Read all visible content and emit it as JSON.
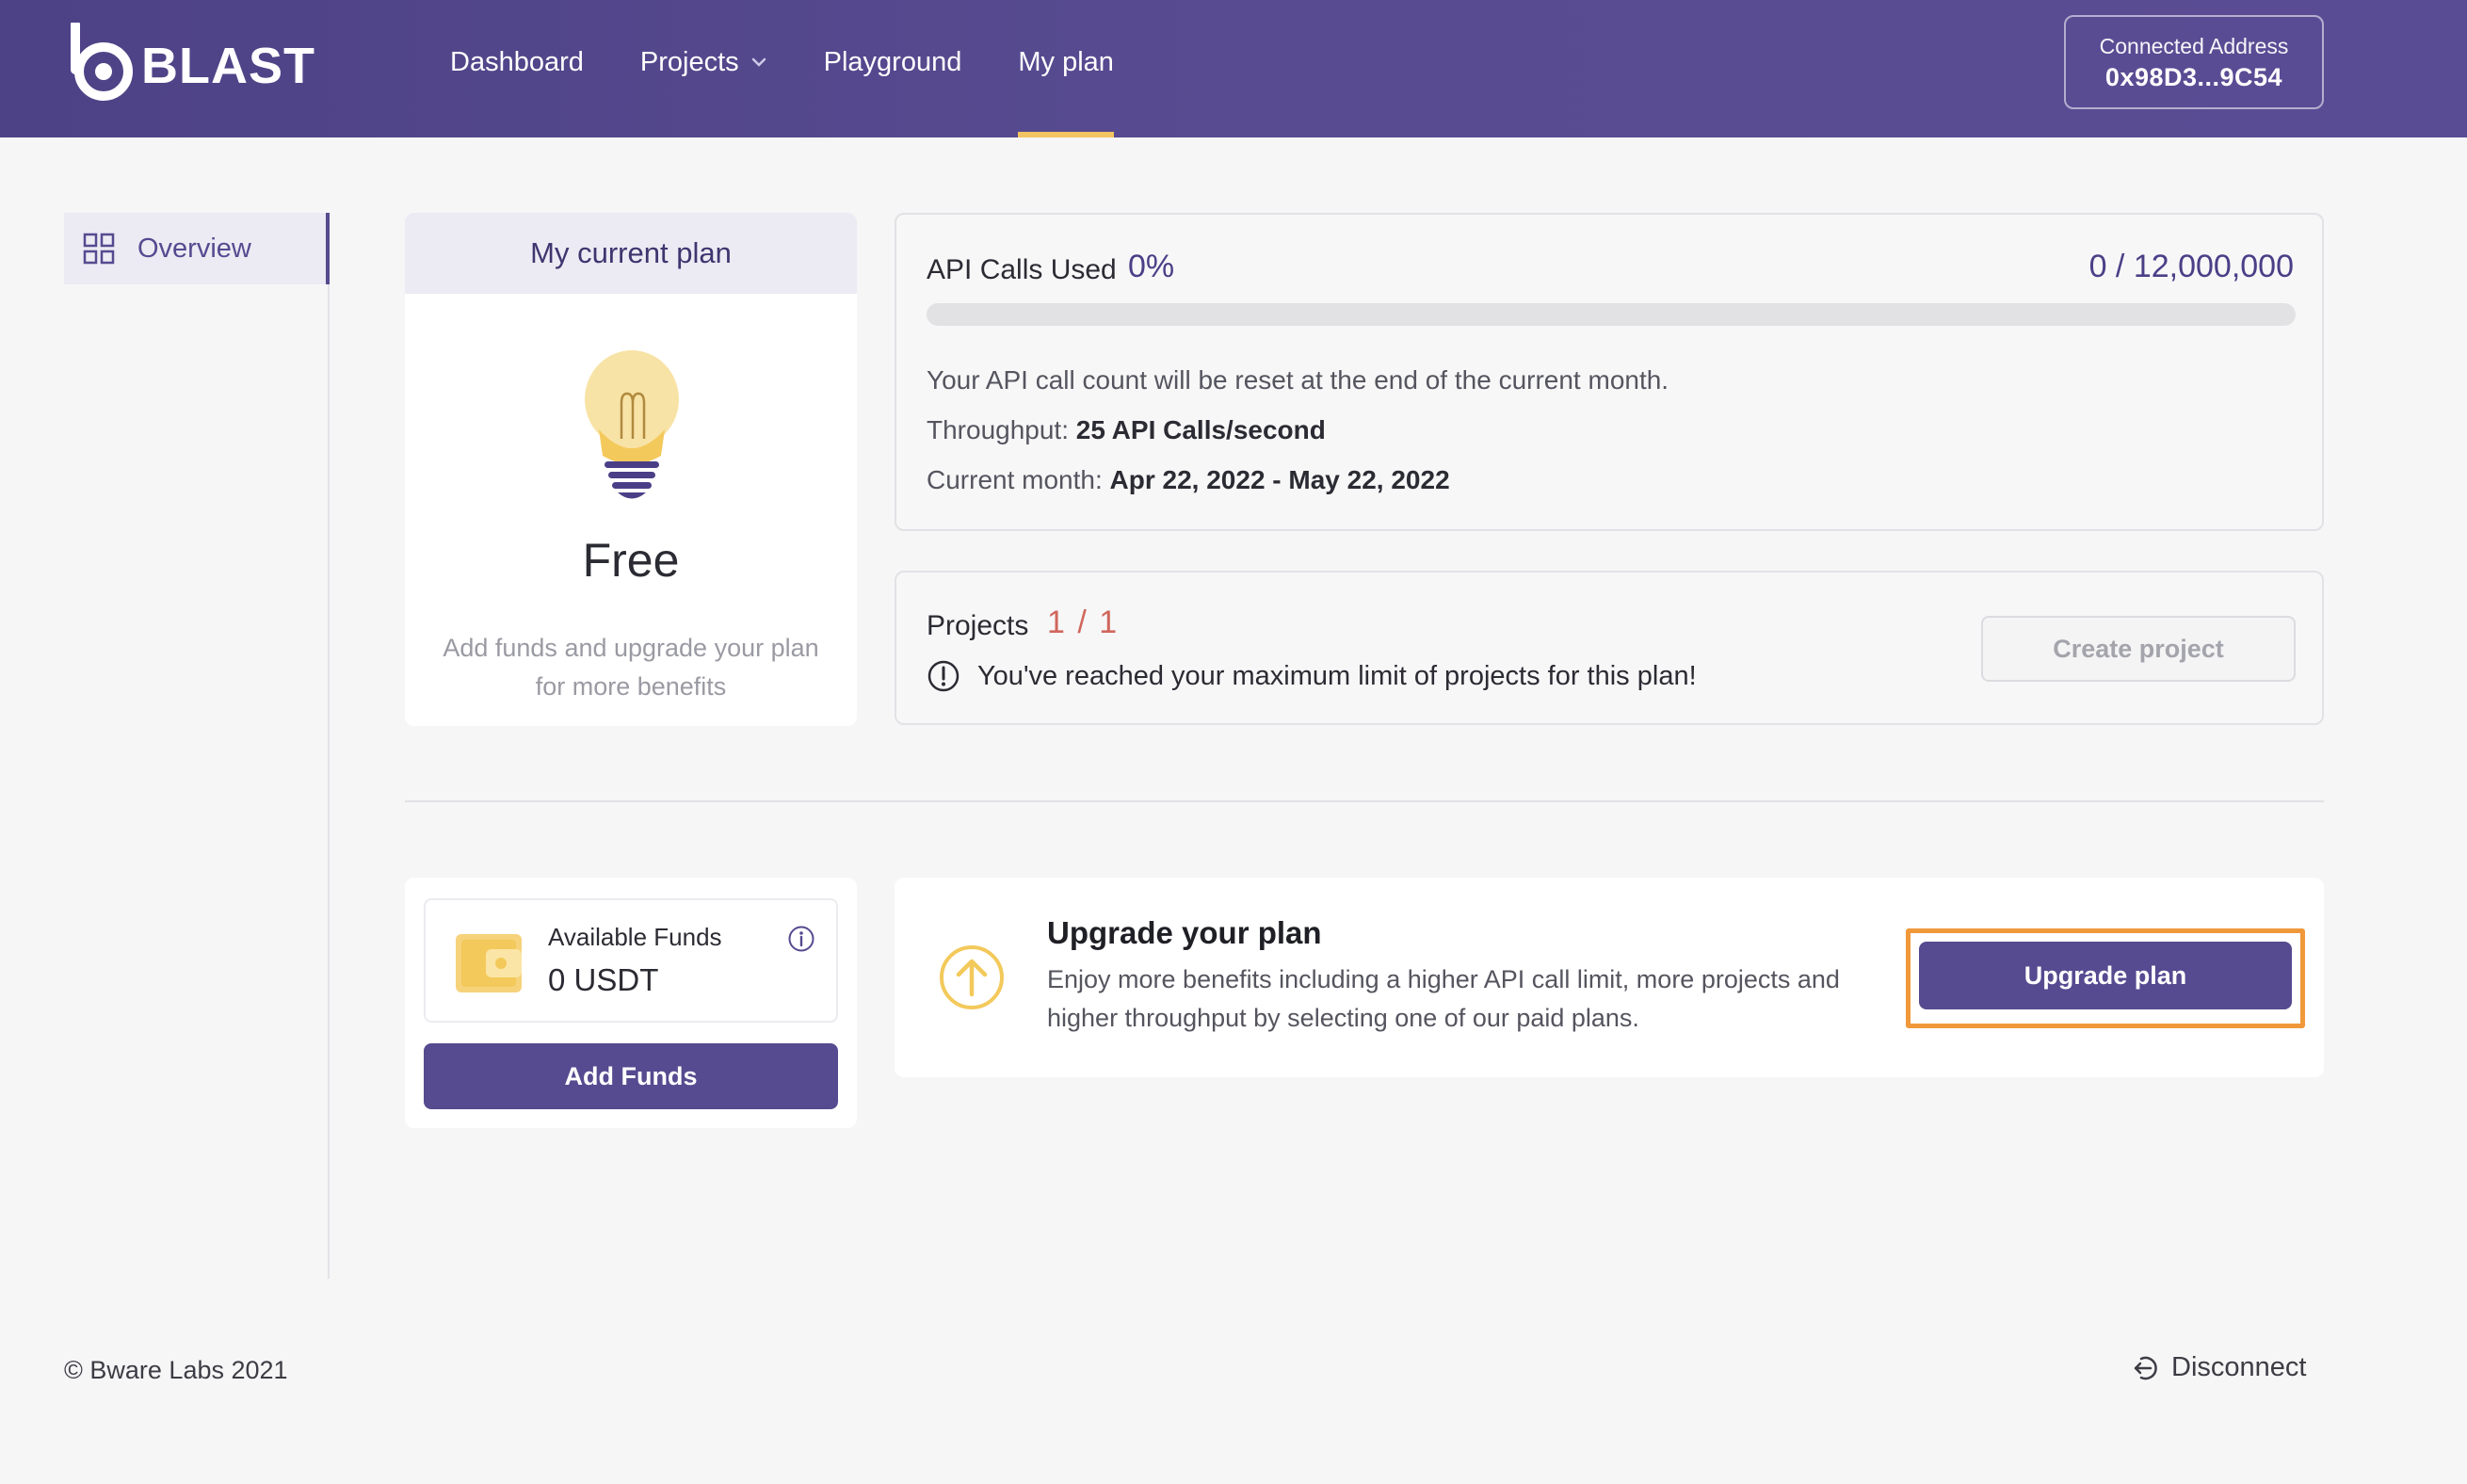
{
  "header": {
    "brand": "BLAST",
    "nav": [
      {
        "label": "Dashboard"
      },
      {
        "label": "Projects"
      },
      {
        "label": "Playground"
      },
      {
        "label": "My plan"
      }
    ],
    "address_label": "Connected Address",
    "address_value": "0x98D3...9C54"
  },
  "sidebar": {
    "items": [
      {
        "label": "Overview",
        "icon": "grid-icon"
      }
    ]
  },
  "plan": {
    "header": "My current plan",
    "name": "Free",
    "desc_line1": "Add funds and upgrade your plan",
    "desc_line2": "for more benefits"
  },
  "api": {
    "title": "API Calls Used",
    "percent": "0%",
    "count": "0 / 12,000,000",
    "progress_fraction": 0,
    "reset_note": "Your API call count will be reset at the end of the current month.",
    "throughput_label": "Throughput:",
    "throughput_value": "25 API Calls/second",
    "month_label": "Current month:",
    "month_value": "Apr 22, 2022 - May 22, 2022"
  },
  "projects": {
    "title": "Projects",
    "count": "1 / 1",
    "warning": "You've reached your maximum limit of projects for this plan!",
    "create_label": "Create project"
  },
  "funds": {
    "label": "Available Funds",
    "value": "0 USDT",
    "button": "Add Funds"
  },
  "upgrade": {
    "title": "Upgrade your plan",
    "desc_line1": "Enjoy more benefits including a higher API call limit, more projects and",
    "desc_line2": "higher throughput by selecting one of our paid plans.",
    "button": "Upgrade plan"
  },
  "footer": {
    "copyright": "© Bware Labs 2021",
    "disconnect": "Disconnect"
  },
  "colors": {
    "brand": "#564a90",
    "accent": "#f2c462",
    "highlight": "#f0983a",
    "warning": "#d0665c"
  }
}
